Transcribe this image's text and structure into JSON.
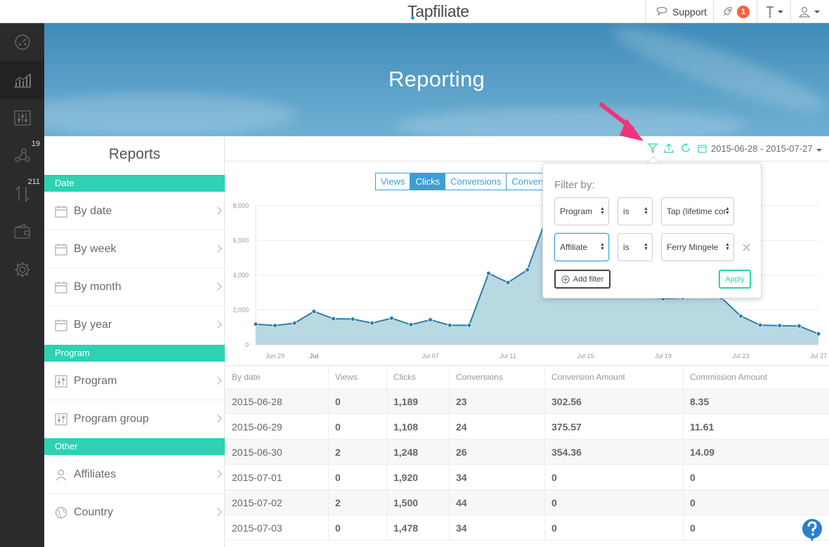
{
  "app": {
    "logo": "Tapfiliate"
  },
  "topbar": {
    "support_label": "Support",
    "notification_count": "1"
  },
  "leftnav": {
    "items": [
      {
        "icon": "dashboard-icon"
      },
      {
        "icon": "chart-icon",
        "active": true
      },
      {
        "icon": "sliders-icon"
      },
      {
        "icon": "network-icon",
        "count": "19"
      },
      {
        "icon": "transfer-icon",
        "count": "211"
      },
      {
        "icon": "wallet-icon"
      },
      {
        "icon": "gear-icon"
      }
    ]
  },
  "hero": {
    "title": "Reporting"
  },
  "sidebar": {
    "title": "Reports",
    "sections": {
      "date": {
        "label": "Date",
        "items": [
          "By date",
          "By week",
          "By month",
          "By year"
        ]
      },
      "program": {
        "label": "Program",
        "items": [
          "Program",
          "Program group"
        ]
      },
      "other": {
        "label": "Other",
        "items": [
          "Affiliates",
          "Country"
        ]
      }
    }
  },
  "toolbar": {
    "date_range": "2015-06-28 - 2015-07-27"
  },
  "tabs": [
    "Views",
    "Clicks",
    "Conversions",
    "Conversio"
  ],
  "chart_data": {
    "type": "area",
    "x": [
      "2015-06-28",
      "2015-06-29",
      "2015-06-30",
      "2015-07-01",
      "2015-07-02",
      "2015-07-03",
      "2015-07-04",
      "2015-07-05",
      "2015-07-06",
      "2015-07-07",
      "2015-07-08",
      "2015-07-09",
      "2015-07-10",
      "2015-07-11",
      "2015-07-12",
      "2015-07-13",
      "2015-07-14",
      "2015-07-15",
      "2015-07-16",
      "2015-07-17",
      "2015-07-18",
      "2015-07-19",
      "2015-07-20",
      "2015-07-21",
      "2015-07-22",
      "2015-07-23",
      "2015-07-24",
      "2015-07-25",
      "2015-07-26",
      "2015-07-27"
    ],
    "series": [
      {
        "values": [
          1189,
          1108,
          1248,
          1920,
          1500,
          1478,
          1250,
          1530,
          1160,
          1440,
          1120,
          1120,
          4110,
          3580,
          4310,
          7350,
          8000,
          6500,
          5300,
          3600,
          2800,
          2650,
          2700,
          2800,
          2700,
          1650,
          1130,
          1100,
          1080,
          630
        ]
      }
    ],
    "xticks": [
      {
        "x": "2015-06-29",
        "label": "Jun 29"
      },
      {
        "x": "2015-07-01",
        "label": "Jul",
        "bold": true
      },
      {
        "x": "2015-07-07",
        "label": "Jul 07"
      },
      {
        "x": "2015-07-11",
        "label": "Jul 11"
      },
      {
        "x": "2015-07-15",
        "label": "Jul 15"
      },
      {
        "x": "2015-07-19",
        "label": "Jul 19"
      },
      {
        "x": "2015-07-23",
        "label": "Jul 23"
      },
      {
        "x": "2015-07-27",
        "label": "Jul 27"
      }
    ],
    "yticks": [
      "0",
      "2,000",
      "4,000",
      "6,000",
      "8,000"
    ],
    "ylim": [
      0,
      8000
    ],
    "grid": true,
    "colors": {
      "line": "#2e7fa8",
      "fill": "#b8d8e2"
    }
  },
  "table": {
    "columns": [
      "By date",
      "Views",
      "Clicks",
      "Conversions",
      "Conversion Amount",
      "Commission Amount"
    ],
    "rows": [
      [
        "2015-06-28",
        "0",
        "1,189",
        "23",
        "302.56",
        "8.35"
      ],
      [
        "2015-06-29",
        "0",
        "1,108",
        "24",
        "375.57",
        "11.61"
      ],
      [
        "2015-06-30",
        "2",
        "1,248",
        "26",
        "354.36",
        "14.09"
      ],
      [
        "2015-07-01",
        "0",
        "1,920",
        "34",
        "0",
        "0"
      ],
      [
        "2015-07-02",
        "2",
        "1,500",
        "44",
        "0",
        "0"
      ],
      [
        "2015-07-03",
        "0",
        "1,478",
        "34",
        "0",
        "0"
      ]
    ]
  },
  "filter": {
    "title": "Filter by:",
    "rows": [
      {
        "field": "Program",
        "op": "is",
        "value": "Tap (lifetime cor"
      },
      {
        "field": "Affiliate",
        "op": "is",
        "value": "Ferry Mingele"
      }
    ],
    "add_label": "Add filter",
    "apply_label": "Apply"
  },
  "colors": {
    "accent": "#2ed1b3",
    "tab": "#3a9fd6",
    "arrow": "#f0337a",
    "badge": "#f0653d"
  }
}
